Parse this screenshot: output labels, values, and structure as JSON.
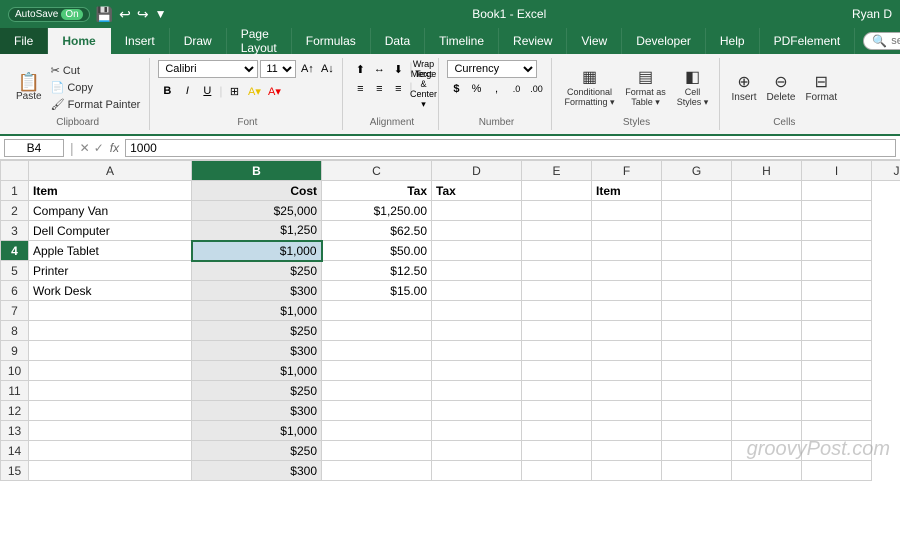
{
  "titleBar": {
    "autosave": "AutoSave",
    "autosaveState": "On",
    "fileName": "Book1 - Excel",
    "userName": "Ryan D"
  },
  "tabs": [
    {
      "label": "File",
      "active": false
    },
    {
      "label": "Home",
      "active": true
    },
    {
      "label": "Insert",
      "active": false
    },
    {
      "label": "Draw",
      "active": false
    },
    {
      "label": "Page Layout",
      "active": false
    },
    {
      "label": "Formulas",
      "active": false
    },
    {
      "label": "Data",
      "active": false
    },
    {
      "label": "Timeline",
      "active": false
    },
    {
      "label": "Review",
      "active": false
    },
    {
      "label": "View",
      "active": false
    },
    {
      "label": "Developer",
      "active": false
    },
    {
      "label": "Help",
      "active": false
    },
    {
      "label": "PDFelement",
      "active": false
    }
  ],
  "ribbon": {
    "groups": [
      {
        "label": "Clipboard"
      },
      {
        "label": "Font"
      },
      {
        "label": "Alignment"
      },
      {
        "label": "Number"
      },
      {
        "label": "Styles"
      },
      {
        "label": "Cells"
      },
      {
        "label": ""
      }
    ],
    "fontName": "Calibri",
    "fontSize": "11",
    "numberFormat": "Currency",
    "wrapText": "Wrap Text",
    "mergeCenter": "Merge & Center",
    "dollarSign": "$",
    "percent": "%",
    "comma": ",",
    "increaseDecimal": ".0",
    "decreaseDecimal": ".00",
    "conditionalFormatting": "Conditional Formatting",
    "formatAsTable": "Format as Table",
    "cellStyles": "Cell Styles",
    "insertBtn": "Insert",
    "deleteBtn": "Delete",
    "formatBtn": "Format"
  },
  "formulaBar": {
    "cellRef": "B4",
    "fx": "fx",
    "value": "1000"
  },
  "search": {
    "placeholder": "search"
  },
  "columns": [
    "",
    "A",
    "B",
    "C",
    "D",
    "E",
    "F",
    "G",
    "H",
    "I",
    "J"
  ],
  "rows": [
    {
      "rowNum": "1",
      "cells": {
        "A": "Item",
        "B": "Cost",
        "C": "Tax",
        "D": "Tax",
        "E": "",
        "F": "Item",
        "G": "",
        "H": "",
        "I": ""
      }
    },
    {
      "rowNum": "2",
      "cells": {
        "A": "Company Van",
        "B": "$25,000",
        "C": "$1,250.00",
        "D": "",
        "E": "",
        "F": "",
        "G": "",
        "H": "",
        "I": ""
      }
    },
    {
      "rowNum": "3",
      "cells": {
        "A": "Dell Computer",
        "B": "$1,250",
        "C": "$62.50",
        "D": "",
        "E": "",
        "F": "",
        "G": "",
        "H": "",
        "I": ""
      }
    },
    {
      "rowNum": "4",
      "cells": {
        "A": "Apple Tablet",
        "B": "$1,000",
        "C": "$50.00",
        "D": "",
        "E": "",
        "F": "",
        "G": "",
        "H": "",
        "I": ""
      }
    },
    {
      "rowNum": "5",
      "cells": {
        "A": "Printer",
        "B": "$250",
        "C": "$12.50",
        "D": "",
        "E": "",
        "F": "",
        "G": "",
        "H": "",
        "I": ""
      }
    },
    {
      "rowNum": "6",
      "cells": {
        "A": "Work Desk",
        "B": "$300",
        "C": "$15.00",
        "D": "",
        "E": "",
        "F": "",
        "G": "",
        "H": "",
        "I": ""
      }
    },
    {
      "rowNum": "7",
      "cells": {
        "A": "",
        "B": "$1,000",
        "C": "",
        "D": "",
        "E": "",
        "F": "",
        "G": "",
        "H": "",
        "I": ""
      }
    },
    {
      "rowNum": "8",
      "cells": {
        "A": "",
        "B": "$250",
        "C": "",
        "D": "",
        "E": "",
        "F": "",
        "G": "",
        "H": "",
        "I": ""
      }
    },
    {
      "rowNum": "9",
      "cells": {
        "A": "",
        "B": "$300",
        "C": "",
        "D": "",
        "E": "",
        "F": "",
        "G": "",
        "H": "",
        "I": ""
      }
    },
    {
      "rowNum": "10",
      "cells": {
        "A": "",
        "B": "$1,000",
        "C": "",
        "D": "",
        "E": "",
        "F": "",
        "G": "",
        "H": "",
        "I": ""
      }
    },
    {
      "rowNum": "11",
      "cells": {
        "A": "",
        "B": "$250",
        "C": "",
        "D": "",
        "E": "",
        "F": "",
        "G": "",
        "H": "",
        "I": ""
      }
    },
    {
      "rowNum": "12",
      "cells": {
        "A": "",
        "B": "$300",
        "C": "",
        "D": "",
        "E": "",
        "F": "",
        "G": "",
        "H": "",
        "I": ""
      }
    },
    {
      "rowNum": "13",
      "cells": {
        "A": "",
        "B": "$1,000",
        "C": "",
        "D": "",
        "E": "",
        "F": "",
        "G": "",
        "H": "",
        "I": ""
      }
    },
    {
      "rowNum": "14",
      "cells": {
        "A": "",
        "B": "$250",
        "C": "",
        "D": "",
        "E": "",
        "F": "",
        "G": "",
        "H": "",
        "I": ""
      }
    },
    {
      "rowNum": "15",
      "cells": {
        "A": "",
        "B": "$300",
        "C": "",
        "D": "",
        "E": "",
        "F": "",
        "G": "",
        "H": "",
        "I": ""
      }
    }
  ],
  "watermark": "groovyPost.com"
}
